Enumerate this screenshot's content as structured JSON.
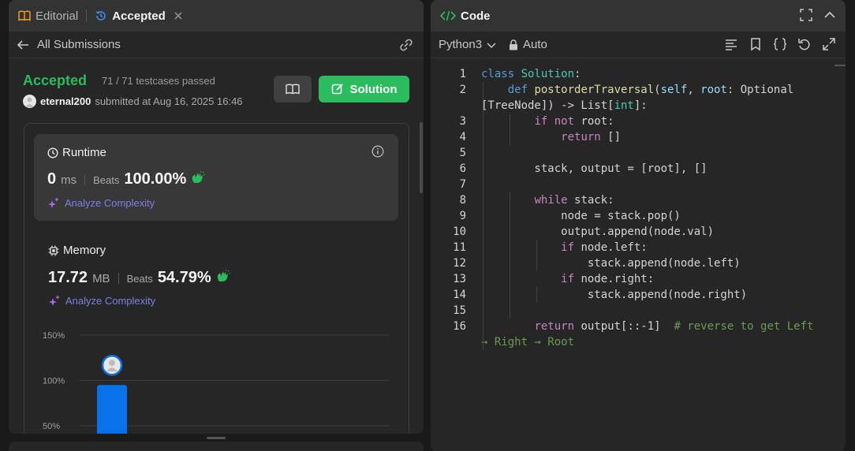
{
  "left_panel": {
    "tabs": [
      {
        "label": "Editorial",
        "icon": "book-icon"
      },
      {
        "label": "Accepted",
        "icon": "history-icon"
      }
    ],
    "back_label": "All Submissions",
    "status": "Accepted",
    "testcases": "71 / 71 testcases passed",
    "username": "eternal200",
    "submitted_text": "submitted at Aug 16, 2025 16:46",
    "solution_button": "Solution",
    "runtime": {
      "title": "Runtime",
      "value": "0",
      "unit": "ms",
      "beats_label": "Beats",
      "beats_value": "100.00%",
      "analyze": "Analyze Complexity"
    },
    "memory": {
      "title": "Memory",
      "value": "17.72",
      "unit": "MB",
      "beats_label": "Beats",
      "beats_value": "54.79%",
      "analyze": "Analyze Complexity"
    }
  },
  "chart_data": {
    "type": "bar",
    "ytick_labels": [
      "150%",
      "100%",
      "50%"
    ],
    "ylim": [
      50,
      150
    ],
    "values": [
      95
    ],
    "bar_color": "#0a72e8",
    "grid": true
  },
  "right_panel": {
    "title": "Code",
    "language": "Python3",
    "auto_label": "Auto",
    "code_lines": [
      {
        "n": "1",
        "segments": [
          [
            "kw2",
            "class "
          ],
          [
            "cls",
            "Solution"
          ],
          [
            "p",
            ":"
          ]
        ]
      },
      {
        "n": "2",
        "segments": [
          [
            "p",
            "    "
          ],
          [
            "kw2",
            "def "
          ],
          [
            "fn",
            "postorderTraversal"
          ],
          [
            "p",
            "("
          ],
          [
            "sf",
            "self"
          ],
          [
            "p",
            ", "
          ],
          [
            "sf",
            "root"
          ],
          [
            "p",
            ": Optional"
          ]
        ]
      },
      {
        "n": "",
        "segments": [
          [
            "p",
            "[TreeNode]) -> List["
          ],
          [
            "cls",
            "int"
          ],
          [
            "p",
            "]:"
          ]
        ]
      },
      {
        "n": "3",
        "segments": [
          [
            "p",
            "        "
          ],
          [
            "kw",
            "if not "
          ],
          [
            "p",
            "root:"
          ]
        ]
      },
      {
        "n": "4",
        "segments": [
          [
            "p",
            "            "
          ],
          [
            "kw",
            "return "
          ],
          [
            "p",
            "[]"
          ]
        ]
      },
      {
        "n": "5",
        "segments": [
          [
            "p",
            ""
          ]
        ]
      },
      {
        "n": "6",
        "segments": [
          [
            "p",
            "        stack, output = [root], []"
          ]
        ]
      },
      {
        "n": "7",
        "segments": [
          [
            "p",
            ""
          ]
        ]
      },
      {
        "n": "8",
        "segments": [
          [
            "p",
            "        "
          ],
          [
            "kw",
            "while "
          ],
          [
            "p",
            "stack:"
          ]
        ]
      },
      {
        "n": "9",
        "segments": [
          [
            "p",
            "            node = stack.pop()"
          ]
        ]
      },
      {
        "n": "10",
        "segments": [
          [
            "p",
            "            output.append(node.val)"
          ]
        ]
      },
      {
        "n": "11",
        "segments": [
          [
            "p",
            "            "
          ],
          [
            "kw",
            "if "
          ],
          [
            "p",
            "node.left:"
          ]
        ]
      },
      {
        "n": "12",
        "segments": [
          [
            "p",
            "                stack.append(node.left)"
          ]
        ]
      },
      {
        "n": "13",
        "segments": [
          [
            "p",
            "            "
          ],
          [
            "kw",
            "if "
          ],
          [
            "p",
            "node.right:"
          ]
        ]
      },
      {
        "n": "14",
        "segments": [
          [
            "p",
            "                stack.append(node.right)"
          ]
        ]
      },
      {
        "n": "15",
        "segments": [
          [
            "p",
            ""
          ]
        ]
      },
      {
        "n": "16",
        "segments": [
          [
            "p",
            "        "
          ],
          [
            "kw",
            "return "
          ],
          [
            "p",
            "output[::-1]  "
          ],
          [
            "cm",
            "# reverse to get Left"
          ]
        ]
      },
      {
        "n": "",
        "segments": [
          [
            "cm",
            "→ Right → Root"
          ]
        ]
      }
    ]
  },
  "colors": {
    "accent_green": "#2cbb5d",
    "analyze_purple": "#7f7fe5",
    "bar_blue": "#0a72e8"
  }
}
